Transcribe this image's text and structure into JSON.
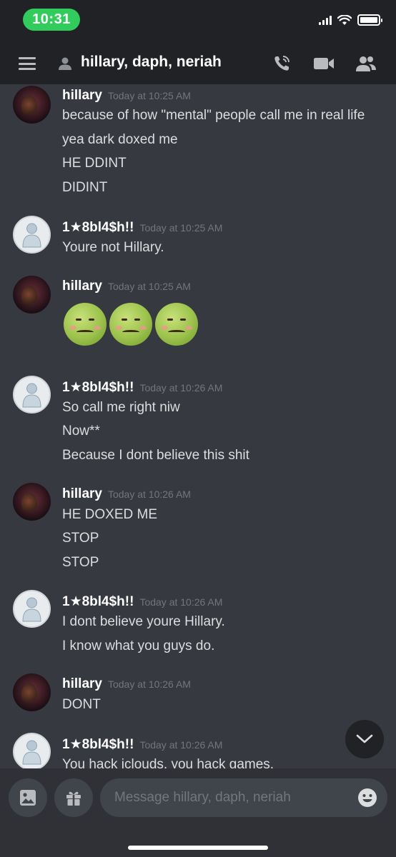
{
  "status_bar": {
    "time": "10:31"
  },
  "header": {
    "title": "hillary, daph, neriah"
  },
  "messages": [
    {
      "author": "hillary",
      "timestamp": "Today at 10:25 AM",
      "avatar": "photo",
      "lines": [
        "because of how \"mental\" people call me in real life",
        "yea dark doxed me",
        "HE DDINT",
        "DIDINT"
      ]
    },
    {
      "author": "1★8bl4$h!!",
      "timestamp": "Today at 10:25 AM",
      "avatar": "default",
      "lines": [
        "Youre not Hillary."
      ]
    },
    {
      "author": "hillary",
      "timestamp": "Today at 10:25 AM",
      "avatar": "photo",
      "emojis": [
        "nauseated-face",
        "nauseated-face",
        "nauseated-face"
      ]
    },
    {
      "author": "1★8bl4$h!!",
      "timestamp": "Today at 10:26 AM",
      "avatar": "default",
      "lines": [
        "So call me right niw",
        "Now**",
        "Because I dont believe this shit"
      ]
    },
    {
      "author": "hillary",
      "timestamp": "Today at 10:26 AM",
      "avatar": "photo",
      "lines": [
        "HE DOXED ME",
        "STOP",
        "STOP"
      ]
    },
    {
      "author": "1★8bl4$h!!",
      "timestamp": "Today at 10:26 AM",
      "avatar": "default",
      "lines": [
        "I dont believe youre Hillary.",
        "I know what you guys do."
      ]
    },
    {
      "author": "hillary",
      "timestamp": "Today at 10:26 AM",
      "avatar": "photo",
      "lines": [
        "DONT"
      ]
    },
    {
      "author": "1★8bl4$h!!",
      "timestamp": "Today at 10:26 AM",
      "avatar": "default",
      "lines": [
        "You hack iclouds, you hack games."
      ]
    }
  ],
  "composer": {
    "placeholder": "Message hillary, daph, neriah"
  },
  "colors": {
    "background": "#36393f",
    "header": "#202225",
    "composer": "#2f3136",
    "status_pill": "#32cc5c"
  }
}
